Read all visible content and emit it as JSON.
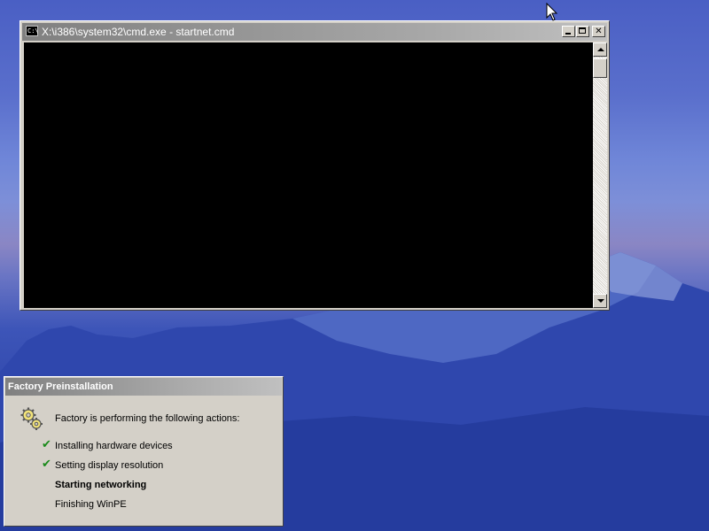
{
  "cmd_window": {
    "title": "X:\\i386\\system32\\cmd.exe - startnet.cmd",
    "icon": "cmd-icon",
    "icon_text": "C:\\"
  },
  "factory_dialog": {
    "title": "Factory Preinstallation",
    "intro": "Factory is performing the following actions:",
    "icon": "gear-icon",
    "steps": [
      {
        "label": "Installing hardware devices",
        "status": "done"
      },
      {
        "label": "Setting display resolution",
        "status": "done"
      },
      {
        "label": "Starting networking",
        "status": "current"
      },
      {
        "label": "Finishing WinPE",
        "status": "pending"
      }
    ]
  },
  "colors": {
    "check": "#1a8a1a",
    "console_bg": "#000000",
    "title_inactive": "#808080"
  }
}
